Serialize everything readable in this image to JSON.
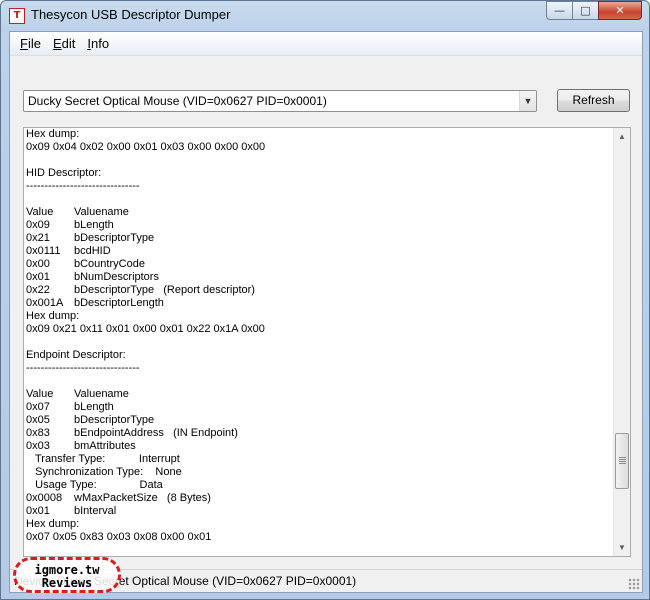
{
  "window": {
    "title": "Thesycon USB Descriptor Dumper",
    "icon": "thesycon-app-icon",
    "caption_buttons": {
      "minimize": "minimize-icon",
      "maximize": "maximize-icon",
      "close": "close-icon"
    }
  },
  "menu": {
    "items": [
      {
        "underline": "F",
        "rest": "ile"
      },
      {
        "underline": "E",
        "rest": "dit"
      },
      {
        "underline": "I",
        "rest": "nfo"
      }
    ]
  },
  "device_select": {
    "value": "Ducky Secret Optical Mouse (VID=0x0627 PID=0x0001)"
  },
  "refresh_label": "Refresh",
  "dump_lines": [
    [
      "Hex dump:"
    ],
    [
      "0x09 0x04 0x02 0x00 0x01 0x03 0x00 0x00 0x00"
    ],
    [
      ""
    ],
    [
      "HID Descriptor:"
    ],
    [
      "-------------------------------"
    ],
    [
      ""
    ],
    [
      "Value",
      "Valuename"
    ],
    [
      "0x09",
      "bLength"
    ],
    [
      "0x21",
      "bDescriptorType"
    ],
    [
      "0x0111",
      "bcdHID"
    ],
    [
      "0x00",
      "bCountryCode"
    ],
    [
      "0x01",
      "bNumDescriptors"
    ],
    [
      "0x22",
      "bDescriptorType   (Report descriptor)"
    ],
    [
      "0x001A",
      "bDescriptorLength"
    ],
    [
      "Hex dump:"
    ],
    [
      "0x09 0x21 0x11 0x01 0x00 0x01 0x22 0x1A 0x00"
    ],
    [
      ""
    ],
    [
      "Endpoint Descriptor:"
    ],
    [
      "-------------------------------"
    ],
    [
      ""
    ],
    [
      "Value",
      "Valuename"
    ],
    [
      "0x07",
      "bLength"
    ],
    [
      "0x05",
      "bDescriptorType"
    ],
    [
      "0x83",
      "bEndpointAddress   (IN Endpoint)"
    ],
    [
      "0x03",
      "bmAttributes"
    ],
    [
      "   Transfer Type:           Interrupt"
    ],
    [
      "   Synchronization Type:    None"
    ],
    [
      "   Usage Type:              Data"
    ],
    [
      "0x0008",
      "wMaxPacketSize   (8 Bytes)"
    ],
    [
      "0x01",
      "bInterval"
    ],
    [
      "Hex dump:"
    ],
    [
      "0x07 0x05 0x83 0x03 0x08 0x00 0x01"
    ]
  ],
  "status_text": "Device: Ducky Secret Optical Mouse (VID=0x0627 PID=0x0001)",
  "watermark": {
    "line1": "igmore.tw",
    "line2": "Reviews"
  }
}
